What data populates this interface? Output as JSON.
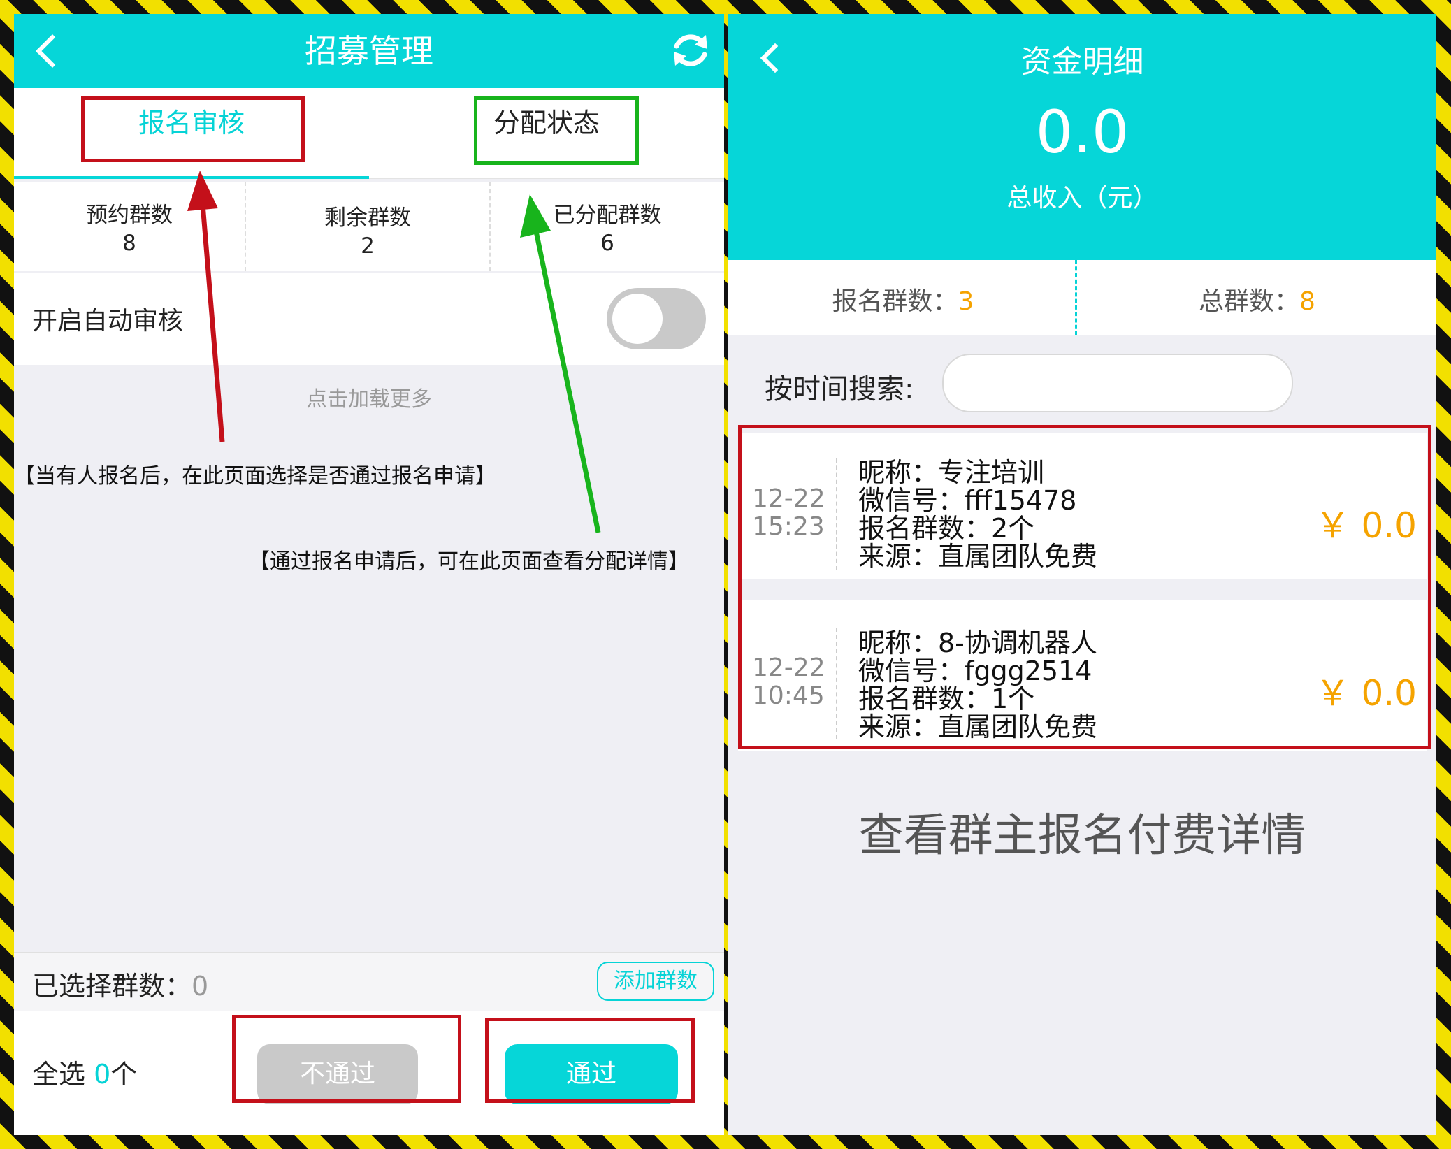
{
  "left": {
    "title": "招募管理",
    "tabs": [
      "报名审核",
      "分配状态"
    ],
    "stats": [
      {
        "label": "预约群数",
        "value": "8"
      },
      {
        "label": "剩余群数",
        "value": "2"
      },
      {
        "label": "已分配群数",
        "value": "6"
      }
    ],
    "auto_review_label": "开启自动审核",
    "auto_review_on": false,
    "load_more": "点击加载更多",
    "annotation_review": "【当有人报名后，在此页面选择是否通过报名申请】",
    "annotation_assign": "【通过报名申请后，可在此页面查看分配详情】",
    "selected_label": "已选择群数：",
    "selected_count": "0",
    "add_groups": "添加群数",
    "select_all_label": "全选",
    "select_all_count": "0",
    "select_all_unit": "个",
    "reject_button": "不通过",
    "approve_button": "通过"
  },
  "right": {
    "title": "资金明细",
    "total_amount": "0.0",
    "total_label": "总收入（元）",
    "signup_groups_label": "报名群数：",
    "signup_groups_value": "3",
    "total_groups_label": "总群数：",
    "total_groups_value": "8",
    "search_label": "按时间搜索:",
    "search_value": "",
    "records": [
      {
        "date": "12-22",
        "time": "15:23",
        "nickname": "昵称：专注培训",
        "wechat": "微信号：fff15478",
        "groups": "报名群数：2个",
        "source": "来源：直属团队免费",
        "amount": "￥ 0.0"
      },
      {
        "date": "12-22",
        "time": "10:45",
        "nickname": "昵称：8-协调机器人",
        "wechat": "微信号：fggg2514",
        "groups": "报名群数：1个",
        "source": "来源：直属团队免费",
        "amount": "￥ 0.0"
      }
    ],
    "caption": "查看群主报名付费详情"
  },
  "colors": {
    "accent": "#06d6d8",
    "amount": "#f5a300",
    "highlight_red": "#c4101a",
    "highlight_green": "#18b41c"
  }
}
